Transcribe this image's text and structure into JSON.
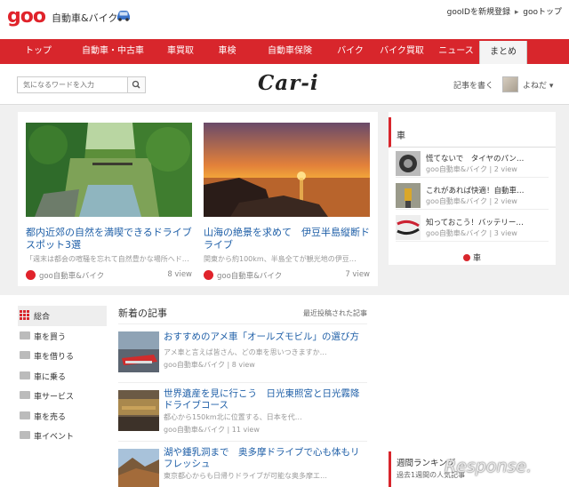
{
  "header": {
    "logo": "goo",
    "site_name": "自動車&バイク",
    "links": [
      "gooIDを新規登録",
      "gooトップ"
    ]
  },
  "nav": {
    "items": [
      "トップ",
      "自動車・中古車",
      "車買取",
      "車検",
      "自動車保険",
      "バイク",
      "バイク買取",
      "ニュース",
      "まとめ"
    ],
    "active_index": 8
  },
  "search": {
    "placeholder": "気になるワードを入力"
  },
  "brand": {
    "logo": "Car-i"
  },
  "user": {
    "write_label": "記事を書く",
    "name": "よねだ"
  },
  "featured": [
    {
      "title": "都内近郊の自然を満喫できるドライブスポット3選",
      "snippet": "「週末は都会の喧騒を忘れて自然豊かな場所へド…",
      "source": "goo自動車&バイク",
      "views": "8 view"
    },
    {
      "title": "山海の絶景を求めて　伊豆半島縦断ドライブ",
      "snippet": "関東から約100km、半島全てが観光地の伊豆…",
      "source": "goo自動車&バイク",
      "views": "7 view"
    }
  ],
  "sidebar_car": {
    "title": "車",
    "items": [
      {
        "title": "慌てないで　タイヤのパン…",
        "meta": "goo自動車&バイク | 2 view"
      },
      {
        "title": "これがあれば快適！自動車…",
        "meta": "goo自動車&バイク | 2 view"
      },
      {
        "title": "知っておこう！バッテリー…",
        "meta": "goo自動車&バイク | 3 view"
      }
    ],
    "more_label": "車"
  },
  "categories": {
    "items": [
      "総合",
      "車を買う",
      "車を借りる",
      "車に乗る",
      "車サービス",
      "車を売る",
      "車イベント"
    ],
    "active_index": 0
  },
  "news": {
    "title": "新着の記事",
    "subtitle": "最近投稿された記事",
    "articles": [
      {
        "title": "おすすめのアメ車「オールズモビル」の選び方",
        "snippet": "アメ車と言えば皆さん、どの車を思いつきますか…",
        "meta": "goo自動車&バイク | 8 view"
      },
      {
        "title": "世界遺産を見に行こう　日光東照宮と日光霧降ドライブコース",
        "snippet": "都心から150km北に位置する、日本を代…",
        "meta": "goo自動車&バイク | 11 view"
      },
      {
        "title": "湖や鍾乳洞まで　奥多摩ドライブで心も体もリフレッシュ",
        "snippet": "東京都心からも日帰りドライブが可能な奥多摩エ…",
        "meta": ""
      }
    ]
  },
  "ranking": {
    "title": "週間ランキング",
    "subtitle": "過去1週間の人気記事"
  },
  "watermark": "Response."
}
